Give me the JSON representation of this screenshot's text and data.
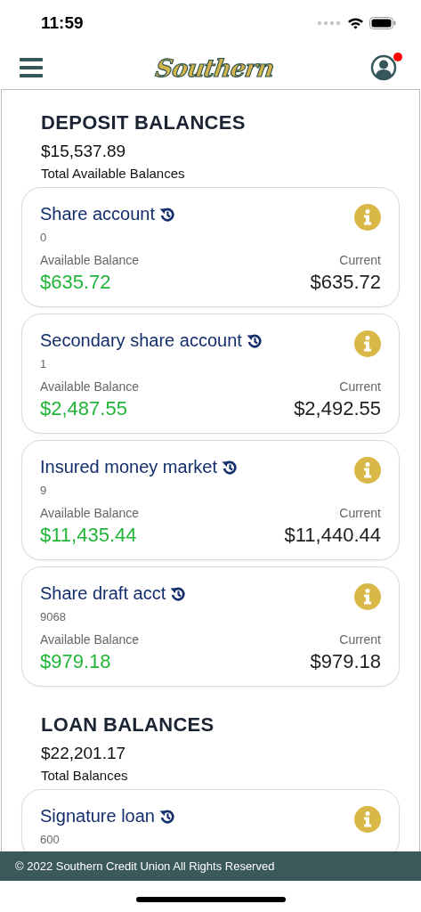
{
  "status_bar": {
    "time": "11:59"
  },
  "header": {
    "logo": "Southern",
    "notification": true
  },
  "sections": [
    {
      "title": "DEPOSIT BALANCES",
      "total": "$15,537.89",
      "total_label": "Total Available Balances",
      "accounts": [
        {
          "name": "Share account",
          "number": "0",
          "left_label": "Available Balance",
          "left_value": "$635.72",
          "right_label": "Current",
          "right_value": "$635.72"
        },
        {
          "name": "Secondary share account",
          "number": "1",
          "left_label": "Available Balance",
          "left_value": "$2,487.55",
          "right_label": "Current",
          "right_value": "$2,492.55"
        },
        {
          "name": "Insured money market",
          "number": "9",
          "left_label": "Available Balance",
          "left_value": "$11,435.44",
          "right_label": "Current",
          "right_value": "$11,440.44"
        },
        {
          "name": "Share draft acct",
          "number": "9068",
          "left_label": "Available Balance",
          "left_value": "$979.18",
          "right_label": "Current",
          "right_value": "$979.18"
        }
      ]
    },
    {
      "title": "LOAN BALANCES",
      "total": "$22,201.17",
      "total_label": "Total Balances",
      "accounts": [
        {
          "name": "Signature loan",
          "number": "600"
        }
      ]
    }
  ],
  "footer": {
    "text": "© 2022 Southern Credit Union All Rights Reserved"
  }
}
